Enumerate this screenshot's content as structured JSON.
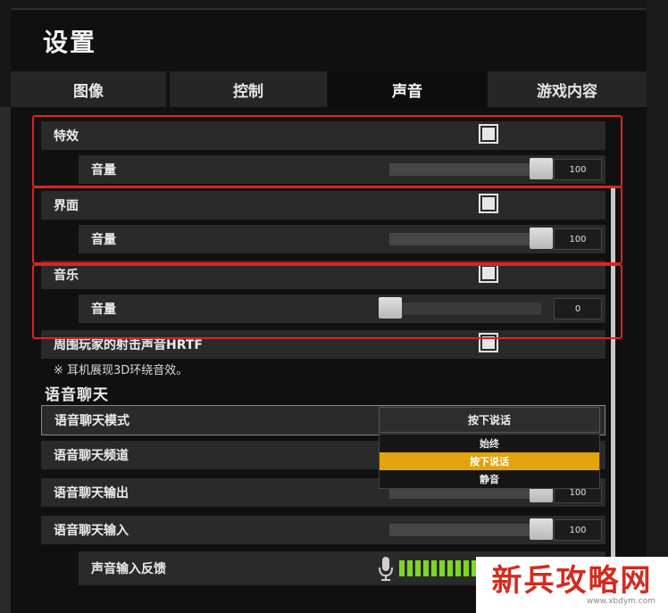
{
  "title": "设置",
  "tabs": [
    {
      "label": "图像"
    },
    {
      "label": "控制"
    },
    {
      "label": "声音"
    },
    {
      "label": "游戏内容"
    }
  ],
  "active_tab": "声音",
  "sound": {
    "effects": {
      "label": "特效",
      "checked": true,
      "volume_label": "音量",
      "volume": "100"
    },
    "interface": {
      "label": "界面",
      "checked": true,
      "volume_label": "音量",
      "volume": "100"
    },
    "music": {
      "label": "音乐",
      "checked": true,
      "volume_label": "音量",
      "volume": "0"
    },
    "hrtf": {
      "label": "周围玩家的射击声音HRTF",
      "checked": true,
      "note": "※ 耳机展现3D环绕音效。"
    }
  },
  "voice_chat": {
    "section_title": "语音聊天",
    "mode": {
      "label": "语音聊天模式",
      "selected": "按下说话",
      "options": [
        "始终",
        "按下说话",
        "静音"
      ]
    },
    "channel": {
      "label": "语音聊天频道"
    },
    "output": {
      "label": "语音聊天输出",
      "volume": "100"
    },
    "input": {
      "label": "语音聊天输入",
      "volume": "100"
    },
    "feedback": {
      "label": "声音输入反馈",
      "level_bars": 12
    }
  },
  "watermark": {
    "text": "新兵攻略网",
    "url": "www.xbdym.com"
  },
  "colors": {
    "accent": "#e3a30c",
    "highlight_border": "#e32020",
    "level_meter": "#7dd622"
  }
}
